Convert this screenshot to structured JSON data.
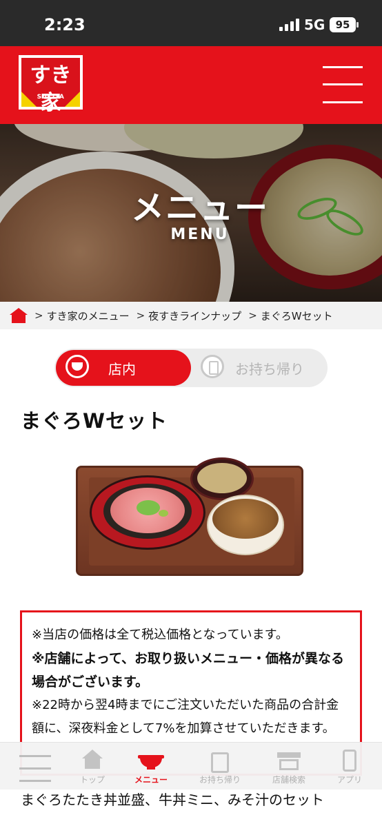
{
  "status": {
    "time": "2:23",
    "network": "5G",
    "battery": "95"
  },
  "header": {
    "logo_text": "すき家",
    "logo_sub": "SUKIYA"
  },
  "hero": {
    "title": "メニュー",
    "subtitle": "MENU"
  },
  "breadcrumb": {
    "items": [
      "すき家のメニュー",
      "夜すきラインナップ",
      "まぐろWセット"
    ]
  },
  "toggle": {
    "dine_in": "店内",
    "takeout": "お持ち帰り",
    "selected": "店内"
  },
  "product": {
    "title": "まぐろWセット"
  },
  "notice": {
    "line1": "※当店の価格は全て税込価格となっています。",
    "line2": "※店舗によって、お取り扱いメニュー・価格が異なる場合がございます。",
    "line3": "※22時から翌4時までにご注文いただいた商品の合計金額に、深夜料金として7%を加算させていただきます。"
  },
  "tabbar": {
    "items": [
      {
        "label": "トップ",
        "icon": "home-icon"
      },
      {
        "label": "メニュー",
        "icon": "bowl-icon",
        "active": true
      },
      {
        "label": "お持ち帰り",
        "icon": "bag-icon"
      },
      {
        "label": "店舗検索",
        "icon": "shop-icon"
      },
      {
        "label": "アプリ",
        "icon": "phone-icon"
      }
    ]
  },
  "description": "まぐろたたき丼並盛、牛丼ミニ、みそ汁のセット",
  "colors": {
    "brand_red": "#e5121b",
    "logo_yellow": "#f5d200"
  }
}
